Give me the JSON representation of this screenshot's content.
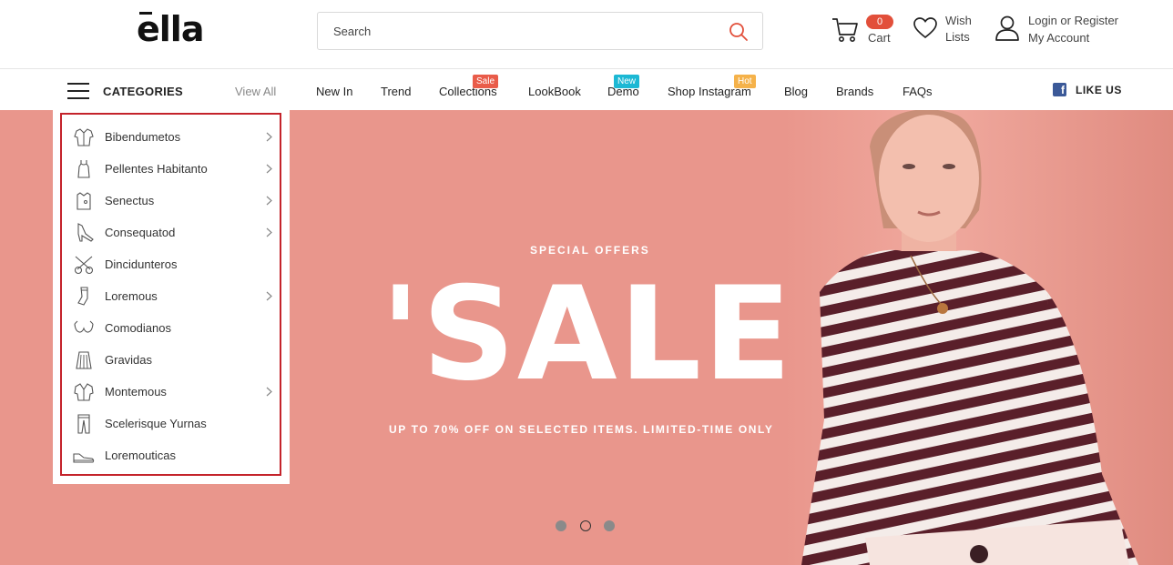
{
  "header": {
    "logo": "ella",
    "search": {
      "placeholder": "Search"
    },
    "cart": {
      "count": "0",
      "label": "Cart"
    },
    "wishlist": {
      "line1": "Wish",
      "line2": "Lists"
    },
    "account": {
      "line1": "Login or Register",
      "line2": "My Account"
    }
  },
  "categories": {
    "title": "CATEGORIES",
    "view_all": "View All",
    "items": [
      {
        "label": "Bibendumetos",
        "icon": "shirt-icon",
        "has_sub": true
      },
      {
        "label": "Pellentes Habitanto",
        "icon": "dress-icon",
        "has_sub": true
      },
      {
        "label": "Senectus",
        "icon": "top-icon",
        "has_sub": true
      },
      {
        "label": "Consequatod",
        "icon": "heel-icon",
        "has_sub": true
      },
      {
        "label": "Dincidunteros",
        "icon": "sunglasses-icon",
        "has_sub": false
      },
      {
        "label": "Loremous",
        "icon": "sock-icon",
        "has_sub": true
      },
      {
        "label": "Comodianos",
        "icon": "bra-icon",
        "has_sub": false
      },
      {
        "label": "Gravidas",
        "icon": "skirt-icon",
        "has_sub": false
      },
      {
        "label": "Montemous",
        "icon": "jacket-icon",
        "has_sub": true
      },
      {
        "label": "Scelerisque Yurnas",
        "icon": "pants-icon",
        "has_sub": false
      },
      {
        "label": "Loremouticas",
        "icon": "sneaker-icon",
        "has_sub": false
      }
    ]
  },
  "nav": {
    "items": [
      {
        "label": "New In"
      },
      {
        "label": "Trend"
      },
      {
        "label": "Collections",
        "tag": "Sale"
      },
      {
        "label": "LookBook"
      },
      {
        "label": "Demo",
        "tag": "New"
      },
      {
        "label": "Shop Instagram",
        "tag": "Hot"
      },
      {
        "label": "Blog"
      },
      {
        "label": "Brands"
      },
      {
        "label": "FAQs"
      }
    ],
    "like_us": "LIKE US"
  },
  "hero": {
    "kicker": "SPECIAL OFFERS",
    "headline": "'SALE",
    "subline": "UP TO 70% OFF ON SELECTED ITEMS. LIMITED-TIME ONLY",
    "slides": 3,
    "active_slide": 2
  },
  "colors": {
    "hero_bg": "#e9968c",
    "cart_badge": "#e24f3a",
    "tag_sale": "#e95c4a",
    "tag_new": "#1cb8d4",
    "tag_hot": "#f5b24a",
    "category_outline": "#c4232b",
    "facebook": "#3b5998"
  }
}
